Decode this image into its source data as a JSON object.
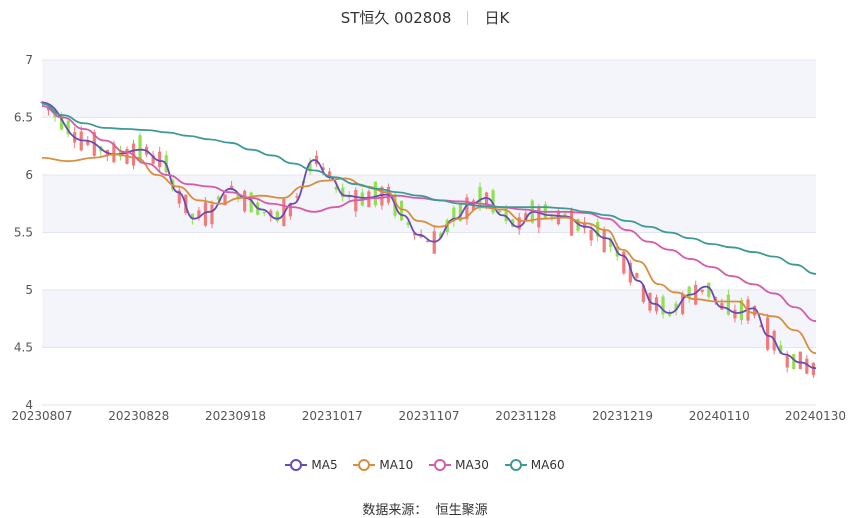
{
  "title": {
    "name": "ST恒久 002808",
    "period": "日K"
  },
  "source": {
    "label": "数据来源：",
    "provider": "恒生聚源"
  },
  "colors": {
    "up": "#ef7b7b",
    "down": "#90e050",
    "band": "#f3f5fb",
    "MA5": "#6a4bb5",
    "MA10": "#d98e3f",
    "MA30": "#d45ca8",
    "MA60": "#3e9a96"
  },
  "chart_data": {
    "type": "candlestick",
    "ylim": [
      4,
      7
    ],
    "yticks": [
      "4",
      "4.5",
      "5",
      "5.5",
      "6",
      "6.5",
      "7"
    ],
    "x_ticks": [
      "20230807",
      "20230828",
      "20230918",
      "20231017",
      "20231107",
      "20231128",
      "20231219",
      "20240110",
      "20240130"
    ],
    "n_days": 120,
    "series": [
      {
        "name": "MA5",
        "points": [
          [
            0,
            6.63
          ],
          [
            8,
            6.3
          ],
          [
            14,
            6.18
          ],
          [
            19,
            6.22
          ],
          [
            23,
            6.12
          ],
          [
            26,
            5.85
          ],
          [
            29,
            5.62
          ],
          [
            32,
            5.68
          ],
          [
            36,
            5.88
          ],
          [
            39,
            5.8
          ],
          [
            42,
            5.7
          ],
          [
            45,
            5.62
          ],
          [
            48,
            5.75
          ],
          [
            52,
            6.13
          ],
          [
            55,
            5.98
          ],
          [
            58,
            5.82
          ],
          [
            62,
            5.8
          ],
          [
            66,
            5.83
          ],
          [
            69,
            5.65
          ],
          [
            72,
            5.48
          ],
          [
            75,
            5.42
          ],
          [
            79,
            5.62
          ],
          [
            82,
            5.75
          ],
          [
            85,
            5.8
          ],
          [
            88,
            5.65
          ],
          [
            91,
            5.55
          ],
          [
            94,
            5.68
          ],
          [
            97,
            5.65
          ],
          [
            100,
            5.64
          ],
          [
            104,
            5.55
          ],
          [
            108,
            5.45
          ],
          [
            111,
            5.3
          ],
          [
            114,
            5.08
          ],
          [
            117,
            4.88
          ],
          [
            120,
            4.8
          ],
          [
            124,
            4.96
          ],
          [
            127,
            5.03
          ],
          [
            130,
            4.85
          ],
          [
            133,
            4.8
          ],
          [
            136,
            4.84
          ],
          [
            139,
            4.6
          ],
          [
            142,
            4.44
          ],
          [
            145,
            4.37
          ],
          [
            148,
            4.32
          ]
        ]
      },
      {
        "name": "MA10",
        "points": [
          [
            0,
            6.15
          ],
          [
            5,
            6.12
          ],
          [
            10,
            6.15
          ],
          [
            14,
            6.18
          ],
          [
            18,
            6.15
          ],
          [
            22,
            6.0
          ],
          [
            26,
            5.9
          ],
          [
            30,
            5.78
          ],
          [
            34,
            5.75
          ],
          [
            38,
            5.8
          ],
          [
            42,
            5.82
          ],
          [
            46,
            5.8
          ],
          [
            50,
            5.9
          ],
          [
            54,
            5.95
          ],
          [
            58,
            5.97
          ],
          [
            62,
            5.9
          ],
          [
            66,
            5.85
          ],
          [
            69,
            5.7
          ],
          [
            72,
            5.6
          ],
          [
            76,
            5.55
          ],
          [
            80,
            5.62
          ],
          [
            84,
            5.72
          ],
          [
            88,
            5.7
          ],
          [
            92,
            5.6
          ],
          [
            96,
            5.62
          ],
          [
            100,
            5.63
          ],
          [
            104,
            5.58
          ],
          [
            108,
            5.52
          ],
          [
            111,
            5.35
          ],
          [
            114,
            5.25
          ],
          [
            118,
            5.05
          ],
          [
            121,
            4.98
          ],
          [
            125,
            4.92
          ],
          [
            129,
            4.9
          ],
          [
            133,
            4.9
          ],
          [
            136,
            4.8
          ],
          [
            140,
            4.77
          ],
          [
            144,
            4.65
          ],
          [
            148,
            4.45
          ]
        ]
      },
      {
        "name": "MA30",
        "points": [
          [
            0,
            6.6
          ],
          [
            4,
            6.5
          ],
          [
            8,
            6.4
          ],
          [
            12,
            6.3
          ],
          [
            16,
            6.2
          ],
          [
            20,
            6.1
          ],
          [
            24,
            6.0
          ],
          [
            28,
            5.92
          ],
          [
            32,
            5.9
          ],
          [
            36,
            5.85
          ],
          [
            40,
            5.8
          ],
          [
            44,
            5.75
          ],
          [
            48,
            5.72
          ],
          [
            52,
            5.68
          ],
          [
            56,
            5.72
          ],
          [
            60,
            5.78
          ],
          [
            64,
            5.8
          ],
          [
            68,
            5.82
          ],
          [
            72,
            5.8
          ],
          [
            76,
            5.78
          ],
          [
            80,
            5.77
          ],
          [
            84,
            5.75
          ],
          [
            88,
            5.72
          ],
          [
            92,
            5.7
          ],
          [
            96,
            5.68
          ],
          [
            100,
            5.68
          ],
          [
            104,
            5.67
          ],
          [
            108,
            5.62
          ],
          [
            112,
            5.52
          ],
          [
            116,
            5.42
          ],
          [
            120,
            5.35
          ],
          [
            124,
            5.27
          ],
          [
            128,
            5.2
          ],
          [
            132,
            5.12
          ],
          [
            136,
            5.05
          ],
          [
            140,
            4.97
          ],
          [
            144,
            4.85
          ],
          [
            148,
            4.73
          ]
        ]
      },
      {
        "name": "MA60",
        "points": [
          [
            0,
            6.62
          ],
          [
            4,
            6.52
          ],
          [
            8,
            6.45
          ],
          [
            12,
            6.41
          ],
          [
            16,
            6.4
          ],
          [
            20,
            6.39
          ],
          [
            24,
            6.37
          ],
          [
            28,
            6.34
          ],
          [
            32,
            6.31
          ],
          [
            36,
            6.28
          ],
          [
            40,
            6.22
          ],
          [
            44,
            6.17
          ],
          [
            48,
            6.1
          ],
          [
            52,
            6.04
          ],
          [
            56,
            5.98
          ],
          [
            60,
            5.92
          ],
          [
            64,
            5.88
          ],
          [
            68,
            5.85
          ],
          [
            72,
            5.82
          ],
          [
            76,
            5.78
          ],
          [
            80,
            5.75
          ],
          [
            84,
            5.73
          ],
          [
            88,
            5.72
          ],
          [
            92,
            5.72
          ],
          [
            96,
            5.72
          ],
          [
            100,
            5.71
          ],
          [
            104,
            5.68
          ],
          [
            108,
            5.65
          ],
          [
            112,
            5.6
          ],
          [
            116,
            5.55
          ],
          [
            120,
            5.5
          ],
          [
            124,
            5.45
          ],
          [
            128,
            5.4
          ],
          [
            132,
            5.37
          ],
          [
            136,
            5.33
          ],
          [
            140,
            5.29
          ],
          [
            144,
            5.22
          ],
          [
            148,
            5.14
          ]
        ]
      }
    ]
  }
}
